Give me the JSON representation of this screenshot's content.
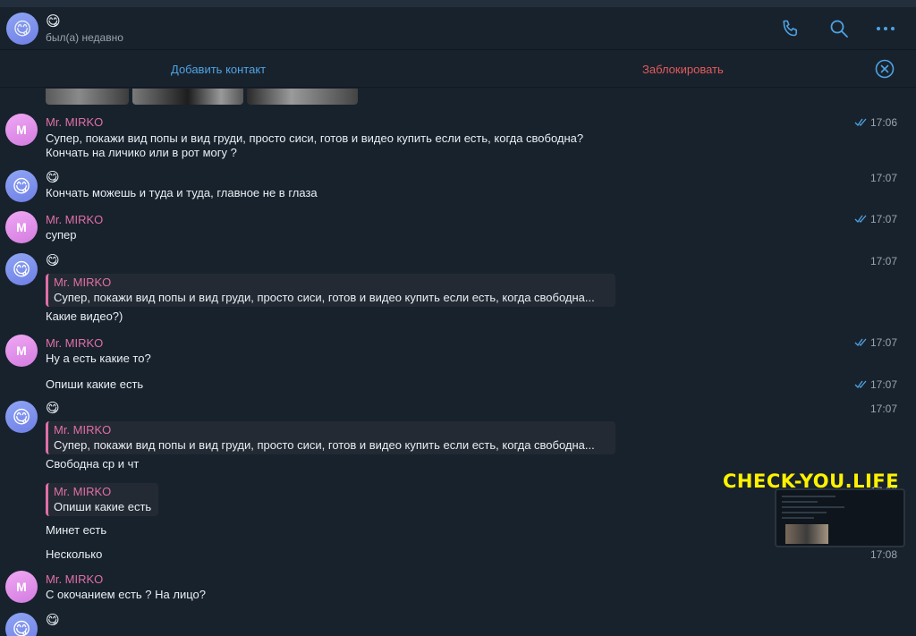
{
  "header": {
    "avatar_emoji": "😋",
    "name": "😋",
    "status": "был(а) недавно",
    "icons": [
      "phone-icon",
      "search-icon",
      "more-icon"
    ]
  },
  "actions": {
    "add_contact": "Добавить контакт",
    "block": "Заблокировать",
    "close_icon": "close-icon"
  },
  "colors": {
    "background": "#18222d",
    "accent_link": "#4fa3e3",
    "danger": "#e35a5a",
    "sender_name": "#e06fa8",
    "watermark": "#fff200"
  },
  "messages": {
    "m1": {
      "avatar": "M",
      "sender": "Mr. MIRKO",
      "line1": "Супер, покажи вид попы и вид груди, просто сиси, готов и видео купить если есть, когда свободна?",
      "line2": "Кончать на личико или в рот могу ?",
      "time": "17:06"
    },
    "m2": {
      "avatar": "😋",
      "sender": "😋",
      "text": "Кончать можешь и туда и туда, главное не в глаза",
      "time": "17:07"
    },
    "m3": {
      "avatar": "M",
      "sender": "Mr. MIRKO",
      "text": "супер",
      "time": "17:07"
    },
    "m4": {
      "avatar": "😋",
      "sender": "😋",
      "quote_name": "Mr. MIRKO",
      "quote_text": "Супер, покажи вид попы и вид груди, просто сиси, готов и видео купить если есть, когда свободна...",
      "text": "Какие видео?)",
      "time": "17:07"
    },
    "m5": {
      "avatar": "M",
      "sender": "Mr. MIRKO",
      "text": "Ну а есть какие то?",
      "time": "17:07"
    },
    "m6": {
      "text": "Опиши какие есть",
      "time": "17:07"
    },
    "m7": {
      "avatar": "😋",
      "sender": "😋",
      "quote_name": "Mr. MIRKO",
      "quote_text": "Супер, покажи вид попы и вид груди, просто сиси, готов и видео купить если есть, когда свободна...",
      "text": "Свободна ср и чт",
      "time": "17:07"
    },
    "m8": {
      "quote_name": "Mr. MIRKO",
      "quote_text": "Опиши какие есть",
      "time": "17:08"
    },
    "m9": {
      "text": "Минет есть"
    },
    "m10": {
      "text": "Несколько",
      "time": "17:08"
    },
    "m11": {
      "avatar": "M",
      "sender": "Mr. MIRKO",
      "text": "С окочанием есть ? На лицо?"
    },
    "m12": {
      "avatar": "😋",
      "sender": "😋"
    }
  },
  "watermark": "CHECK-YOU.LIFE"
}
